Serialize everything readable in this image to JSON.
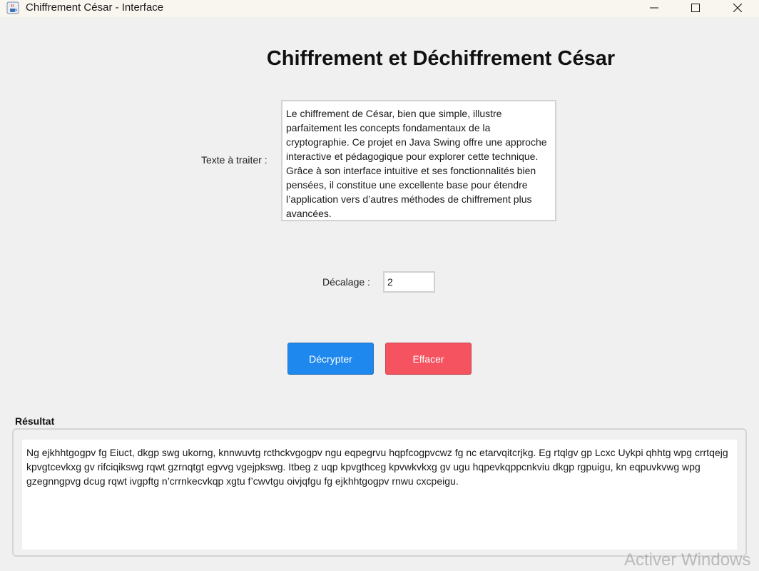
{
  "window": {
    "title": "Chiffrement César - Interface"
  },
  "heading": "Chiffrement et Déchiffrement César",
  "input": {
    "label": "Texte à traiter :",
    "text": "Le chiffrement de César, bien que simple, illustre parfaitement les concepts fondamentaux de la cryptographie. Ce projet en Java Swing offre une approche interactive et pédagogique pour explorer cette technique. Grâce à son interface intuitive et ses fonctionnalités bien pensées, il constitue une excellente base pour étendre l’application vers d’autres méthodes de chiffrement plus avancées."
  },
  "shift": {
    "label": "Décalage :",
    "value": "2"
  },
  "buttons": {
    "decrypt_label": "Décrypter",
    "clear_label": "Effacer"
  },
  "result": {
    "label": "Résultat",
    "text": "Ng ejkhhtgogpv fg Eiuct, dkgp swg ukorng, knnwuvtg rcthckvgogpv ngu eqpegrvu hqpfcogpvcwz fg nc etarvqitcrjkg. Eg rtqlgv gp Lcxc Uykpi qhhtg wpg crrtqejg kpvgtcevkxg gv rifciqikswg rqwt gzrnqtgt egvvg vgejpkswg. Itbeg z uqp kpvgthceg kpvwkvkxg gv ugu hqpevkqppcnkviu dkgp rgpuigu, kn eqpuvkvwg wpg gzegnngpvg dcug rqwt ivgpftg n’crrnkecvkqp xgtu f’cwvtgu oivjqfgu fg ejkhhtgogpv rnwu cxcpeigu."
  },
  "watermark": "Activer Windows",
  "colors": {
    "decrypt_button": "#1e88ee",
    "clear_button": "#f4535f",
    "background": "#f0f0f0"
  },
  "icons": {
    "app": "java-cup-icon",
    "minimize": "minimize-icon",
    "maximize": "maximize-icon",
    "close": "close-icon"
  }
}
